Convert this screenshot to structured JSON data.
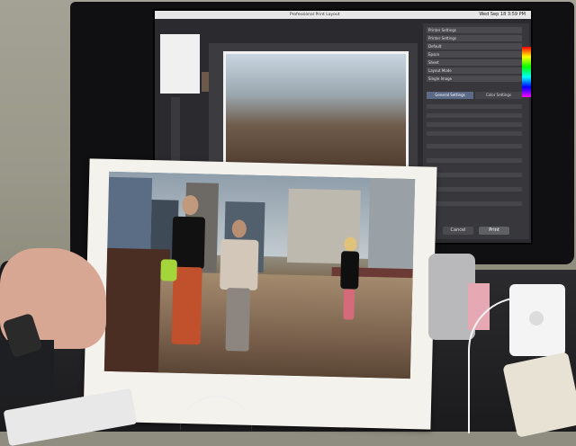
{
  "scene": {
    "monitor": {
      "menubar_clock": "Wed Sep 18 3:59 PM",
      "doc_title": "Professional Print Layout",
      "settings": {
        "rows": [
          "Printer Settings",
          "Printer Settings",
          "Default",
          "Epson",
          "Sheet",
          "Layout Mode",
          "Single Image"
        ],
        "tabs": [
          "General Settings",
          "Color Settings"
        ],
        "cancel_label": "Cancel",
        "print_label": "Print"
      }
    },
    "colors": {
      "wall": "#9a9889",
      "desk": "#1b1b1d",
      "monitor_hood": "#101012",
      "paper": "#f4f2ec",
      "railing": "#6b3a35",
      "shirt_black": "#111111",
      "pants_orange": "#c1502d",
      "bag_green": "#a4d53a"
    }
  }
}
